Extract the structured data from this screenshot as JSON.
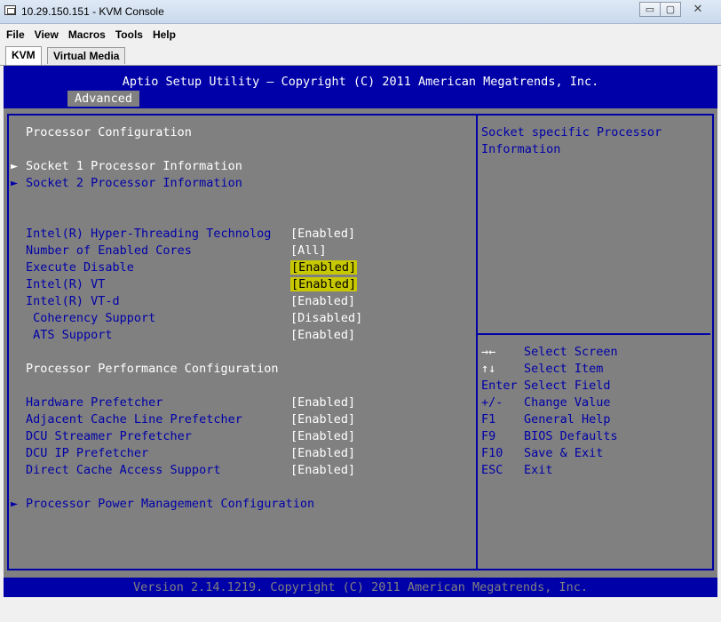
{
  "window": {
    "title": "10.29.150.151 - KVM Console",
    "minimize": "▭",
    "maximize": "▢",
    "close": "✕"
  },
  "menu": [
    "File",
    "View",
    "Macros",
    "Tools",
    "Help"
  ],
  "tabs": [
    "KVM",
    "Virtual Media"
  ],
  "bios": {
    "title": "Aptio Setup Utility – Copyright (C) 2011 American Megatrends, Inc.",
    "active_tab": "Advanced",
    "section_title": "Processor Configuration",
    "submenus": [
      "Socket 1 Processor Information",
      "Socket 2 Processor Information"
    ],
    "settings": [
      {
        "label": "Intel(R) Hyper-Threading Technolog",
        "value": "[Enabled]"
      },
      {
        "label": "Number of Enabled Cores",
        "value": "[All]"
      },
      {
        "label": "Execute Disable",
        "value": "[Enabled]"
      },
      {
        "label": "Intel(R) VT",
        "value": "[Enabled]"
      },
      {
        "label": "Intel(R) VT-d",
        "value": "[Enabled]"
      },
      {
        "label": " Coherency Support",
        "value": "[Disabled]"
      },
      {
        "label": " ATS Support",
        "value": "[Enabled]"
      }
    ],
    "perf_title": "Processor Performance Configuration",
    "perf_settings": [
      {
        "label": "Hardware Prefetcher",
        "value": "[Enabled]"
      },
      {
        "label": "Adjacent Cache Line Prefetcher",
        "value": "[Enabled]"
      },
      {
        "label": "DCU Streamer Prefetcher",
        "value": "[Enabled]"
      },
      {
        "label": "DCU IP Prefetcher",
        "value": "[Enabled]"
      },
      {
        "label": "Direct Cache Access Support",
        "value": "[Enabled]"
      }
    ],
    "power_submenu": "Processor Power Management Configuration",
    "help_text": [
      "Socket specific Processor",
      "Information"
    ],
    "keys": [
      {
        "key": "→←",
        "desc": "Select Screen"
      },
      {
        "key": "↑↓",
        "desc": "Select Item"
      },
      {
        "key": "Enter",
        "desc": "Select Field"
      },
      {
        "key": "+/-",
        "desc": "Change Value"
      },
      {
        "key": "F1",
        "desc": "General Help"
      },
      {
        "key": "F9",
        "desc": "BIOS Defaults"
      },
      {
        "key": "F10",
        "desc": "Save & Exit"
      },
      {
        "key": "ESC",
        "desc": "Exit"
      }
    ],
    "footer": "Version 2.14.1219. Copyright (C) 2011 American Megatrends, Inc.",
    "highlight_color": "#c8c800",
    "header_color": "#0000a8",
    "background_color": "#808080"
  }
}
